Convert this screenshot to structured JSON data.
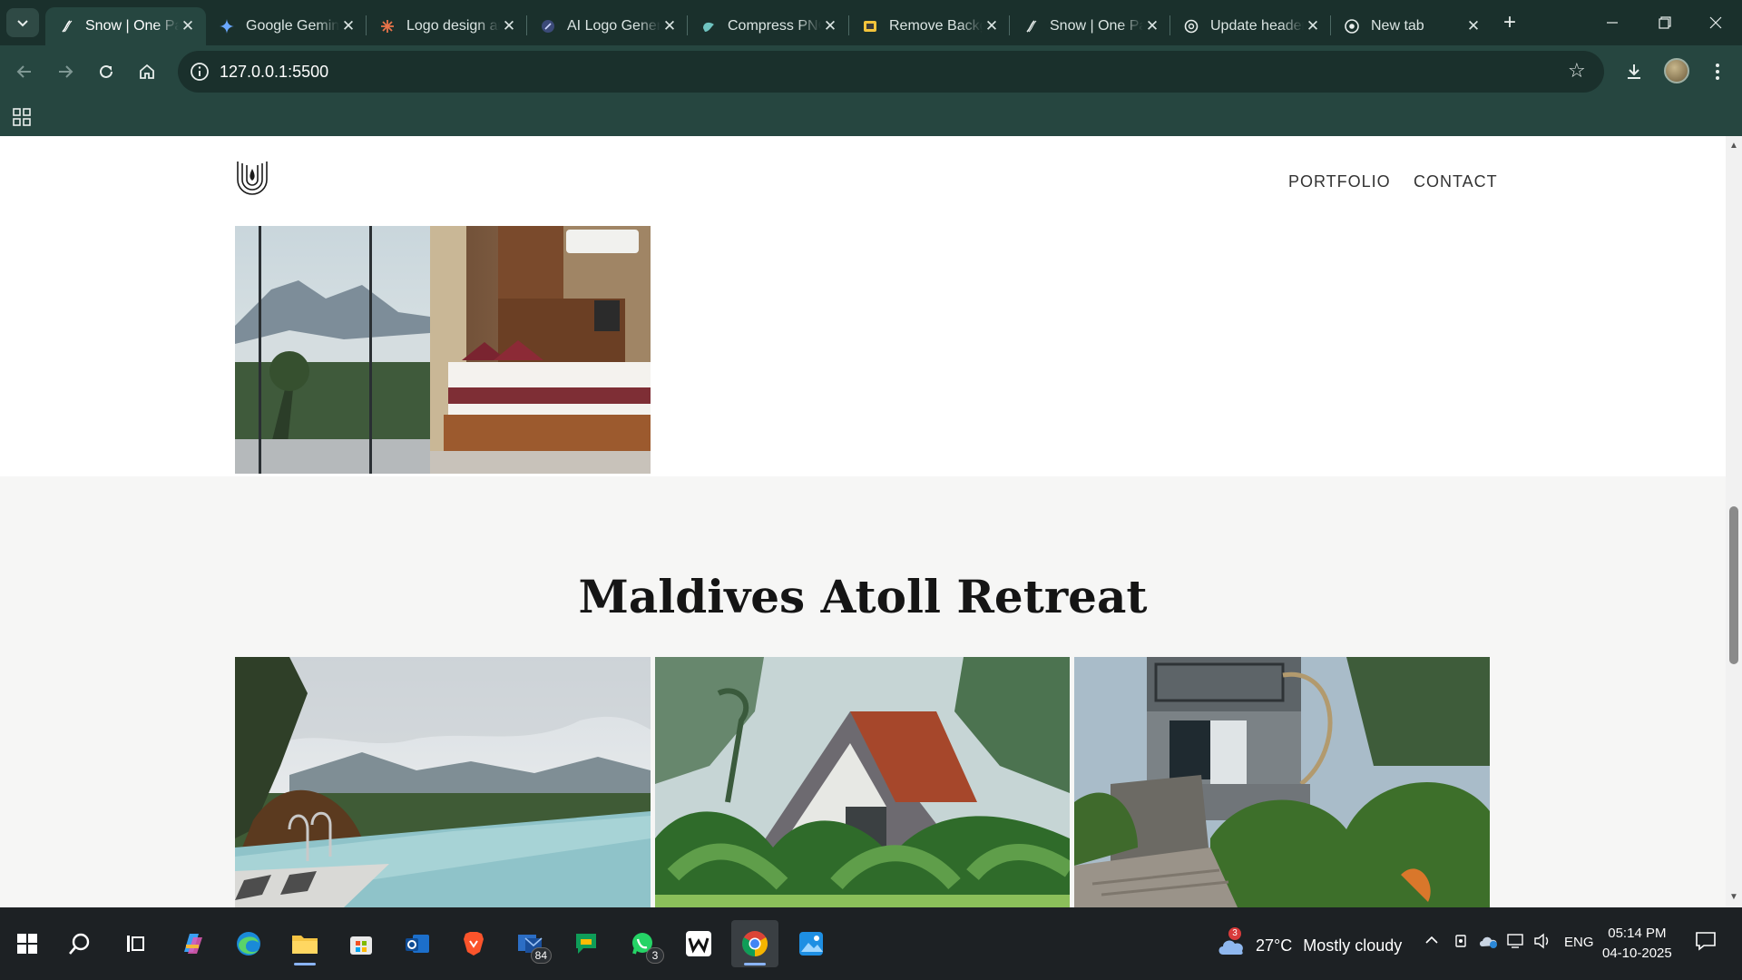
{
  "browser": {
    "tabs": [
      {
        "title": "Snow | One Page",
        "favicon": "snow-icon",
        "active": true
      },
      {
        "title": "Google Gemini",
        "favicon": "gemini-icon",
        "active": false
      },
      {
        "title": "Logo design and",
        "favicon": "logo-design-icon",
        "active": false
      },
      {
        "title": "AI Logo Generator",
        "favicon": "ai-logo-icon",
        "active": false
      },
      {
        "title": "Compress PNG",
        "favicon": "compress-icon",
        "active": false
      },
      {
        "title": "Remove Background",
        "favicon": "remove-bg-icon",
        "active": false
      },
      {
        "title": "Snow | One Page",
        "favicon": "snow-icon",
        "active": false
      },
      {
        "title": "Update header",
        "favicon": "chatgpt-icon",
        "active": false
      },
      {
        "title": "New tab",
        "favicon": "chrome-icon",
        "active": false
      }
    ],
    "url": "127.0.0.1:5500"
  },
  "site": {
    "nav": {
      "portfolio": "PORTFOLIO",
      "contact": "CONTACT"
    },
    "section_title": "Maldives Atoll Retreat"
  },
  "taskbar": {
    "weather": {
      "temp": "27°C",
      "condition": "Mostly cloudy",
      "alert_count": "3"
    },
    "language": "ENG",
    "time": "05:14 PM",
    "date": "04-10-2025",
    "badges": {
      "mail": "84",
      "whatsapp": "3"
    }
  },
  "colors": {
    "browser_frame": "#1a302c",
    "toolbar": "#264640",
    "page_bg": "#ffffff",
    "band_bg": "#f6f6f5",
    "taskbar": "#1d2124"
  }
}
